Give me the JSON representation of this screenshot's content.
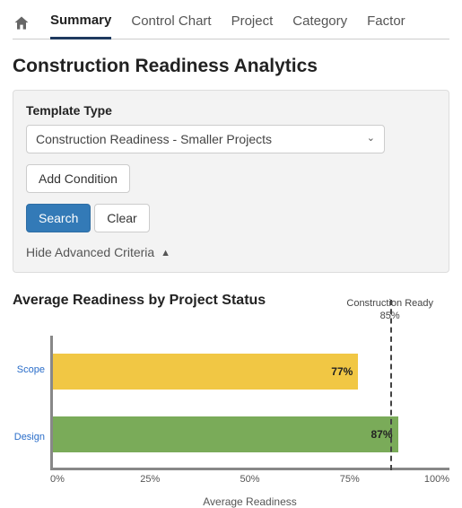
{
  "nav": {
    "tabs": [
      "Summary",
      "Control Chart",
      "Project",
      "Category",
      "Factor"
    ],
    "active": 0
  },
  "page_title": "Construction Readiness Analytics",
  "filter": {
    "label": "Template Type",
    "selected": "Construction Readiness - Smaller Projects",
    "add_condition": "Add Condition",
    "search": "Search",
    "clear": "Clear",
    "hide": "Hide Advanced Criteria"
  },
  "section_title": "Average Readiness by Project Status",
  "chart_data": {
    "type": "bar",
    "orientation": "horizontal",
    "categories": [
      "Scope",
      "Design"
    ],
    "values": [
      77,
      87
    ],
    "value_labels": [
      "77%",
      "87%"
    ],
    "colors": [
      "#f1c744",
      "#7aab59"
    ],
    "xlabel": "Average Readiness",
    "xlim": [
      0,
      100
    ],
    "xticks": [
      0,
      25,
      50,
      75,
      100
    ],
    "xtick_labels": [
      "0%",
      "25%",
      "50%",
      "75%",
      "100%"
    ],
    "reference": {
      "value": 85,
      "label_top": "Construction Ready",
      "label_bottom": "85%"
    }
  }
}
